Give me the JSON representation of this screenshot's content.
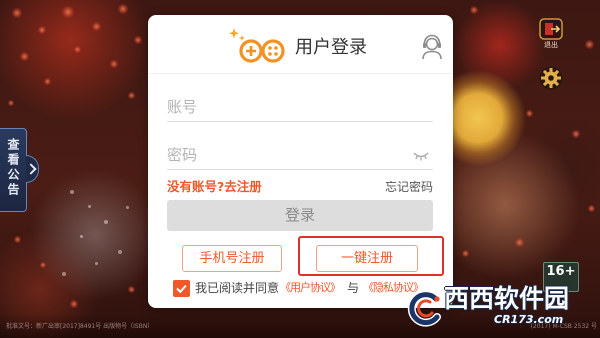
{
  "colors": {
    "accent": "#f0582a",
    "highlight_box": "#e0302a",
    "login_button_bg": "#dddddd",
    "tab_bg": "#22304d"
  },
  "dialog": {
    "title": "用户登录",
    "logo_icon": "game-controller-logo-icon",
    "service_icon": "customer-service-icon",
    "account": {
      "placeholder": "账号",
      "value": ""
    },
    "password": {
      "placeholder": "密码",
      "value": "",
      "visibility_icon": "eye-off-icon"
    },
    "register_link": "没有账号?去注册",
    "forgot_password_link": "忘记密码",
    "login_button": "登录",
    "phone_register_button": "手机号注册",
    "quick_register_button": "一键注册",
    "agreement": {
      "checked": true,
      "prefix": "我已阅读并同意",
      "user_agreement": "《用户协议》",
      "conjunction": "与",
      "privacy_agreement": "《隐私协议》"
    }
  },
  "side_tab": {
    "label": "查看公告",
    "arrow_icon": "chevron-right-icon"
  },
  "top_right": {
    "exit": {
      "label": "退出",
      "icon": "exit-icon"
    },
    "gear": {
      "icon": "gear-icon"
    }
  },
  "age_rating": "16+",
  "watermark": {
    "name": "西西软件园",
    "domain": "CR173.com",
    "icon": "cr173-logo-icon"
  },
  "footer": {
    "left": "批准文号：新广出审[2017]8491号 出版物号（ISBN）",
    "right": "(2017) M-CSB 2532 号"
  }
}
